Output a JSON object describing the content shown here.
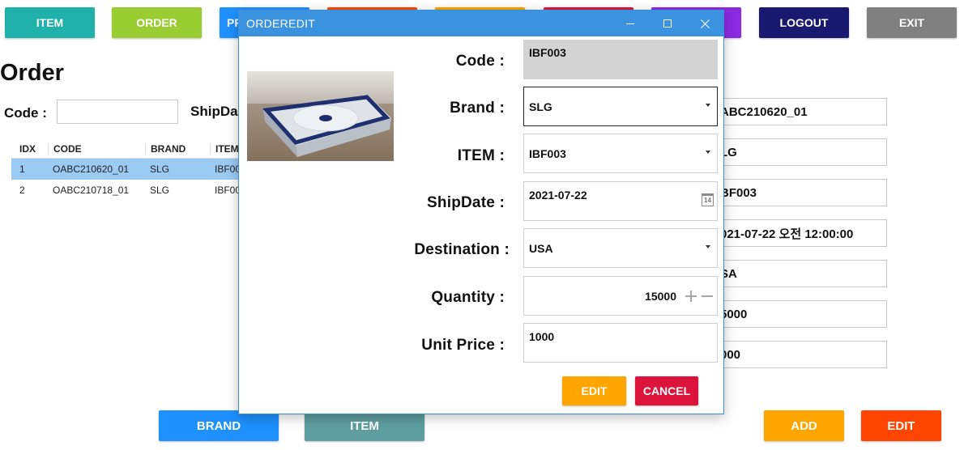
{
  "topbar": {
    "buttons": [
      {
        "label": "ITEM",
        "color": "#20b2aa"
      },
      {
        "label": "ORDER",
        "color": "#9acd32"
      },
      {
        "label": "PR",
        "color": "#1e90ff"
      },
      {
        "label": "",
        "color": "#ff4500"
      },
      {
        "label": "",
        "color": "#ffa500"
      },
      {
        "label": "",
        "color": "#dc143c"
      },
      {
        "label": "",
        "color": "#8a2be2"
      },
      {
        "label": "LOGOUT",
        "color": "#191970"
      },
      {
        "label": "EXIT",
        "color": "#808080"
      }
    ]
  },
  "page": {
    "title": "Order",
    "code_label": "Code :",
    "shipdate_label": "ShipDa"
  },
  "grid": {
    "headers": [
      "IDX",
      "CODE",
      "BRAND",
      "ITEM"
    ],
    "rows": [
      [
        "1",
        "OABC210620_01",
        "SLG",
        "IBF00"
      ],
      [
        "2",
        "OABC210718_01",
        "SLG",
        "IBF00"
      ]
    ]
  },
  "details": {
    "values": [
      "ABC210620_01",
      "LG",
      "BF003",
      "021-07-22 오전 12:00:00",
      "SA",
      "5000",
      "000"
    ]
  },
  "bottom": {
    "brand_label": "BRAND",
    "item_label": "ITEM",
    "add_label": "ADD",
    "edit_label": "EDIT"
  },
  "dialog": {
    "title": "ORDEREDIT",
    "minimize": "—",
    "maximize": "☐",
    "close": "✕",
    "image_icon": "product-image",
    "labels": {
      "code": "Code :",
      "brand": "Brand :",
      "item": "ITEM :",
      "shipdate": "ShipDate :",
      "destination": "Destination :",
      "quantity": "Quantity :",
      "unit_price": "Unit Price :"
    },
    "values": {
      "code": "IBF003",
      "brand": "SLG",
      "item": "IBF003",
      "shipdate": "2021-07-22",
      "destination": "USA",
      "quantity": "15000",
      "unit_price": "1000"
    },
    "calendar_day": "14",
    "edit_label": "EDIT",
    "cancel_label": "CANCEL"
  }
}
